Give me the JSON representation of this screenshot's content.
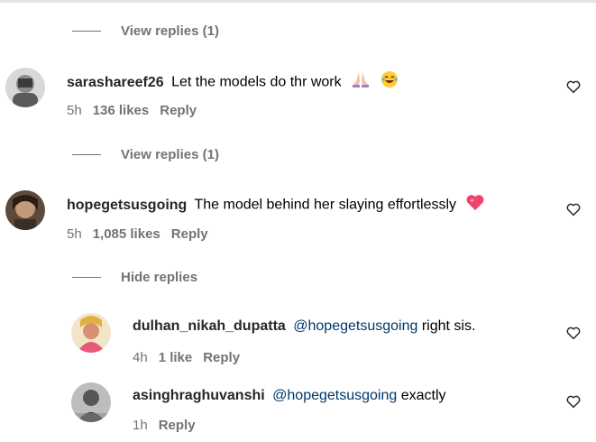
{
  "view_replies_1": "View replies (1)",
  "view_replies_2": "View replies (1)",
  "hide_replies": "Hide replies",
  "comments": [
    {
      "username": "sarashareef26",
      "text": "Let the models do thr work",
      "time": "5h",
      "likes": "136 likes",
      "reply": "Reply"
    },
    {
      "username": "hopegetsusgoing",
      "text": "The model behind her slaying effortlessly",
      "time": "5h",
      "likes": "1,085 likes",
      "reply": "Reply"
    }
  ],
  "replies": [
    {
      "username": "dulhan_nikah_dupatta",
      "mention": "@hopegetsusgoing",
      "text": "right sis.",
      "time": "4h",
      "likes": "1 like",
      "reply": "Reply"
    },
    {
      "username": "asinghraghuvanshi",
      "mention": "@hopegetsusgoing",
      "text": "exactly",
      "time": "1h",
      "reply": "Reply"
    }
  ],
  "icons": {
    "like": "heart-outline-icon",
    "emoji_pray": "praying-hands-emoji",
    "emoji_laugh": "laughing-face-emoji",
    "emoji_heart": "pink-heart-emoji"
  },
  "colors": {
    "secondary_text": "#737373",
    "mention": "#00376b",
    "heart_pink": "#f2436e"
  }
}
